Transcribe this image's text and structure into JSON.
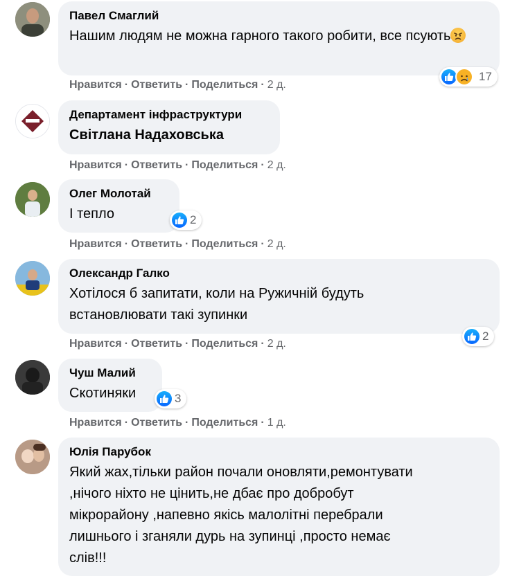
{
  "comments": [
    {
      "author": "Павел Смаглий",
      "text": "Нашим людям не можна гарного такого робити, все псують",
      "emoji": "angry-face-emoji",
      "actions": {
        "like": "Нравится",
        "reply": "Ответить",
        "share": "Поделиться",
        "time": "2 д."
      },
      "reactions": {
        "count": "17",
        "icons": [
          "like-icon",
          "sad-icon"
        ]
      }
    },
    {
      "author": "Департамент інфраструктури",
      "text": "Світлана Надаховська",
      "actions": {
        "like": "Нравится",
        "reply": "Ответить",
        "share": "Поделиться",
        "time": "2 д."
      }
    },
    {
      "author": "Олег Молотай",
      "text": "І тепло",
      "actions": {
        "like": "Нравится",
        "reply": "Ответить",
        "share": "Поделиться",
        "time": "2 д."
      },
      "reactions": {
        "count": "2",
        "icons": [
          "like-icon"
        ]
      }
    },
    {
      "author": "Олександр Галко",
      "text_lines": [
        "Хотілося б запитати, коли на Ружичній будуть",
        "встановлювати такі зупинки"
      ],
      "actions": {
        "like": "Нравится",
        "reply": "Ответить",
        "share": "Поделиться",
        "time": "2 д."
      },
      "reactions": {
        "count": "2",
        "icons": [
          "like-icon"
        ]
      }
    },
    {
      "author": "Чуш Малий",
      "text": "Скотиняки",
      "actions": {
        "like": "Нравится",
        "reply": "Ответить",
        "share": "Поделиться",
        "time": "1 д."
      },
      "reactions": {
        "count": "3",
        "icons": [
          "like-icon"
        ]
      }
    },
    {
      "author": "Юлія Парубок",
      "text_lines": [
        "Який жах,тільки район почали оновляти,ремонтувати",
        ",нічого ніхто не цінить,не дбає про добробут",
        "мікрорайону ,напевно якісь малолітні перебрали",
        "лишнього і зганяли дурь на зупинці ,просто немає",
        "слів!!!"
      ]
    }
  ],
  "separator": "·",
  "colors": {
    "bubble": "#f0f2f5",
    "meta": "#65676b",
    "like": "#0866ff"
  }
}
